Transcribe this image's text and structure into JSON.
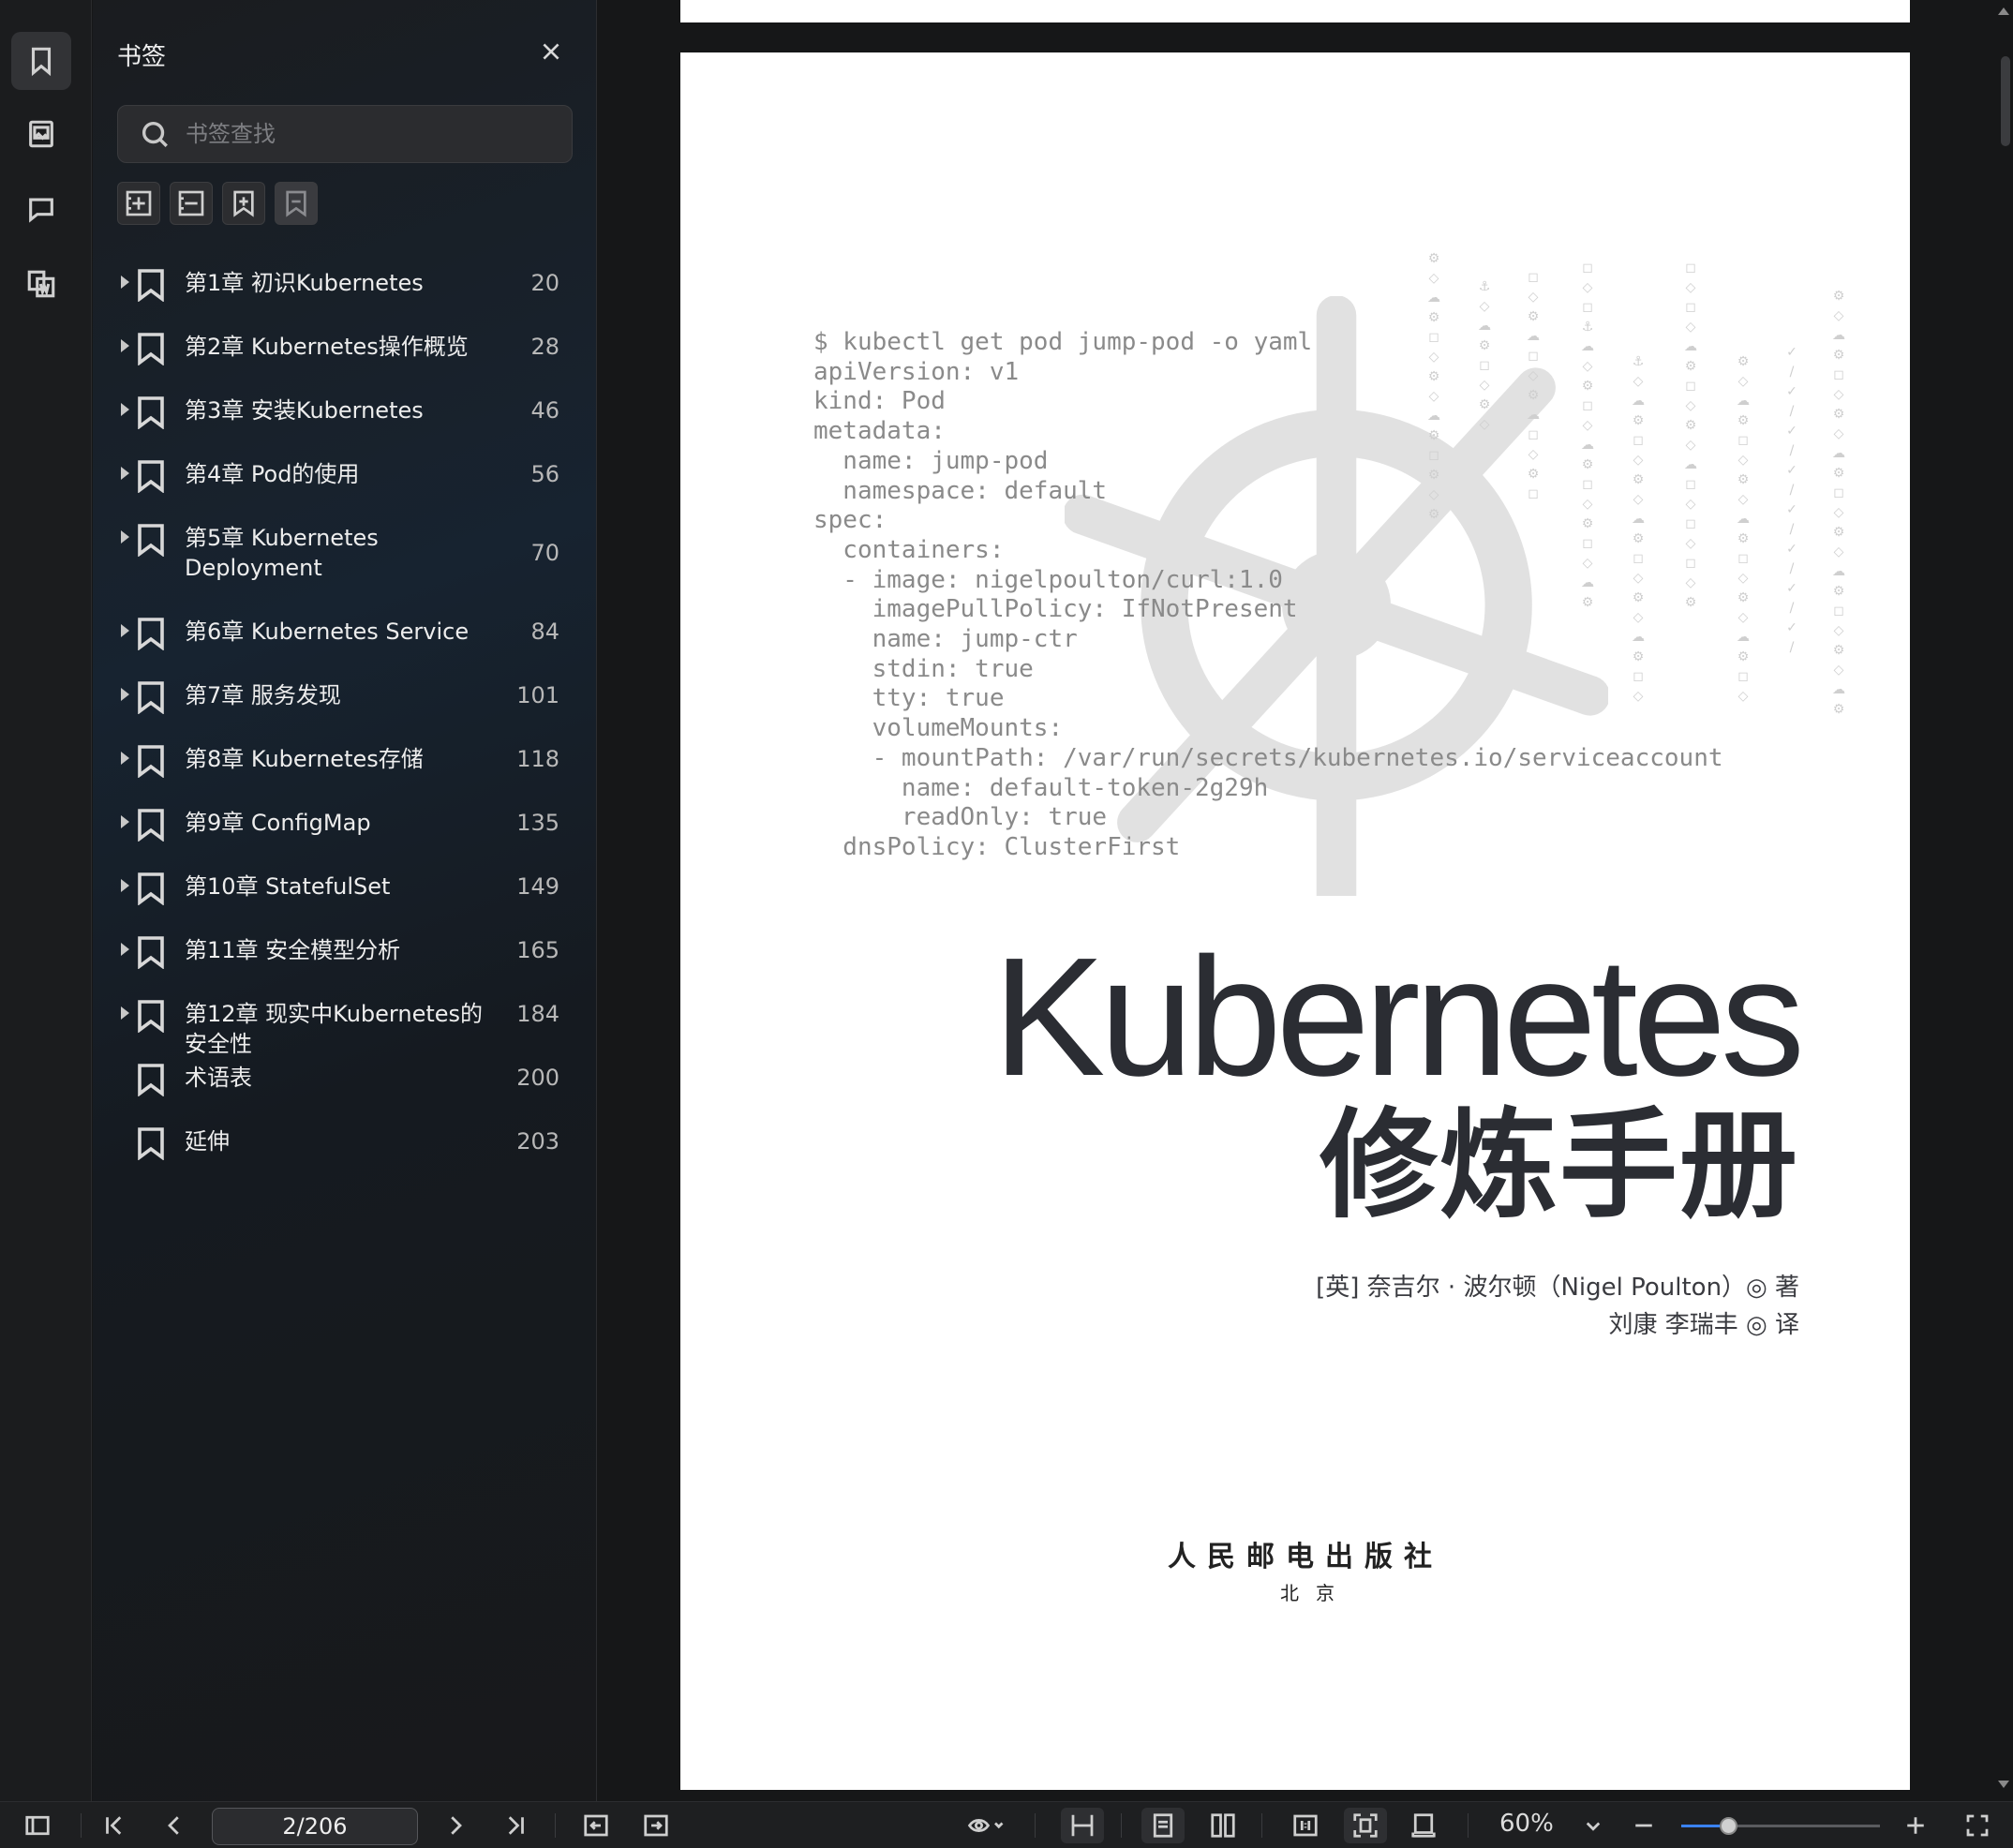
{
  "sidebar_panel": {
    "title": "书签",
    "search_placeholder": "书签查找",
    "tools": [
      "add-bookmark-icon",
      "remove-bookmark-icon",
      "add-child-bookmark-icon",
      "bookmark-outline-icon"
    ]
  },
  "rail": {
    "items": [
      "bookmark-icon",
      "thumbnail-icon",
      "comment-icon",
      "attachment-icon"
    ],
    "active": "bookmark-icon"
  },
  "bookmarks": [
    {
      "label": "第1章 初识Kubernetes",
      "page": "20",
      "expandable": true
    },
    {
      "label": "第2章 Kubernetes操作概览",
      "page": "28",
      "expandable": true
    },
    {
      "label": "第3章 安装Kubernetes",
      "page": "46",
      "expandable": true
    },
    {
      "label": "第4章 Pod的使用",
      "page": "56",
      "expandable": true
    },
    {
      "label": "第5章 Kubernetes Deployment",
      "page": "70",
      "expandable": true
    },
    {
      "label": "第6章 Kubernetes Service",
      "page": "84",
      "expandable": true
    },
    {
      "label": "第7章 服务发现",
      "page": "101",
      "expandable": true
    },
    {
      "label": "第8章 Kubernetes存储",
      "page": "118",
      "expandable": true
    },
    {
      "label": "第9章 ConfigMap",
      "page": "135",
      "expandable": true
    },
    {
      "label": "第10章 StatefulSet",
      "page": "149",
      "expandable": true
    },
    {
      "label": "第11章 安全模型分析",
      "page": "165",
      "expandable": true
    },
    {
      "label": "第12章 现实中Kubernetes的安全性",
      "page": "184",
      "expandable": true
    },
    {
      "label": "术语表",
      "page": "200",
      "expandable": false
    },
    {
      "label": "延伸",
      "page": "203",
      "expandable": false
    }
  ],
  "document": {
    "code_block": "$ kubectl get pod jump-pod -o yaml\napiVersion: v1\nkind: Pod\nmetadata:\n  name: jump-pod\n  namespace: default\nspec:\n  containers:\n  - image: nigelpoulton/curl:1.0\n    imagePullPolicy: IfNotPresent\n    name: jump-ctr\n    stdin: true\n    tty: true\n    volumeMounts:\n    - mountPath: /var/run/secrets/kubernetes.io/serviceaccount\n      name: default-token-2g29h\n      readOnly: true\n  dnsPolicy: ClusterFirst",
    "title": "Kubernetes",
    "subtitle": "修炼手册",
    "author_line": "[英] 奈吉尔 · 波尔顿（Nigel Poulton）◎ 著",
    "translator_line": "刘康 李瑞丰 ◎ 译",
    "publisher": "人民邮电出版社",
    "city": "北京"
  },
  "toolbar": {
    "page_indicator": "2/206",
    "zoom_label": "60%",
    "zoom_slider_value": 0.24
  },
  "colors": {
    "panel_bg": "#1a1c1f",
    "accent": "#3a82f7",
    "page_bg": "#ffffff",
    "title_text": "#2b2d33"
  }
}
